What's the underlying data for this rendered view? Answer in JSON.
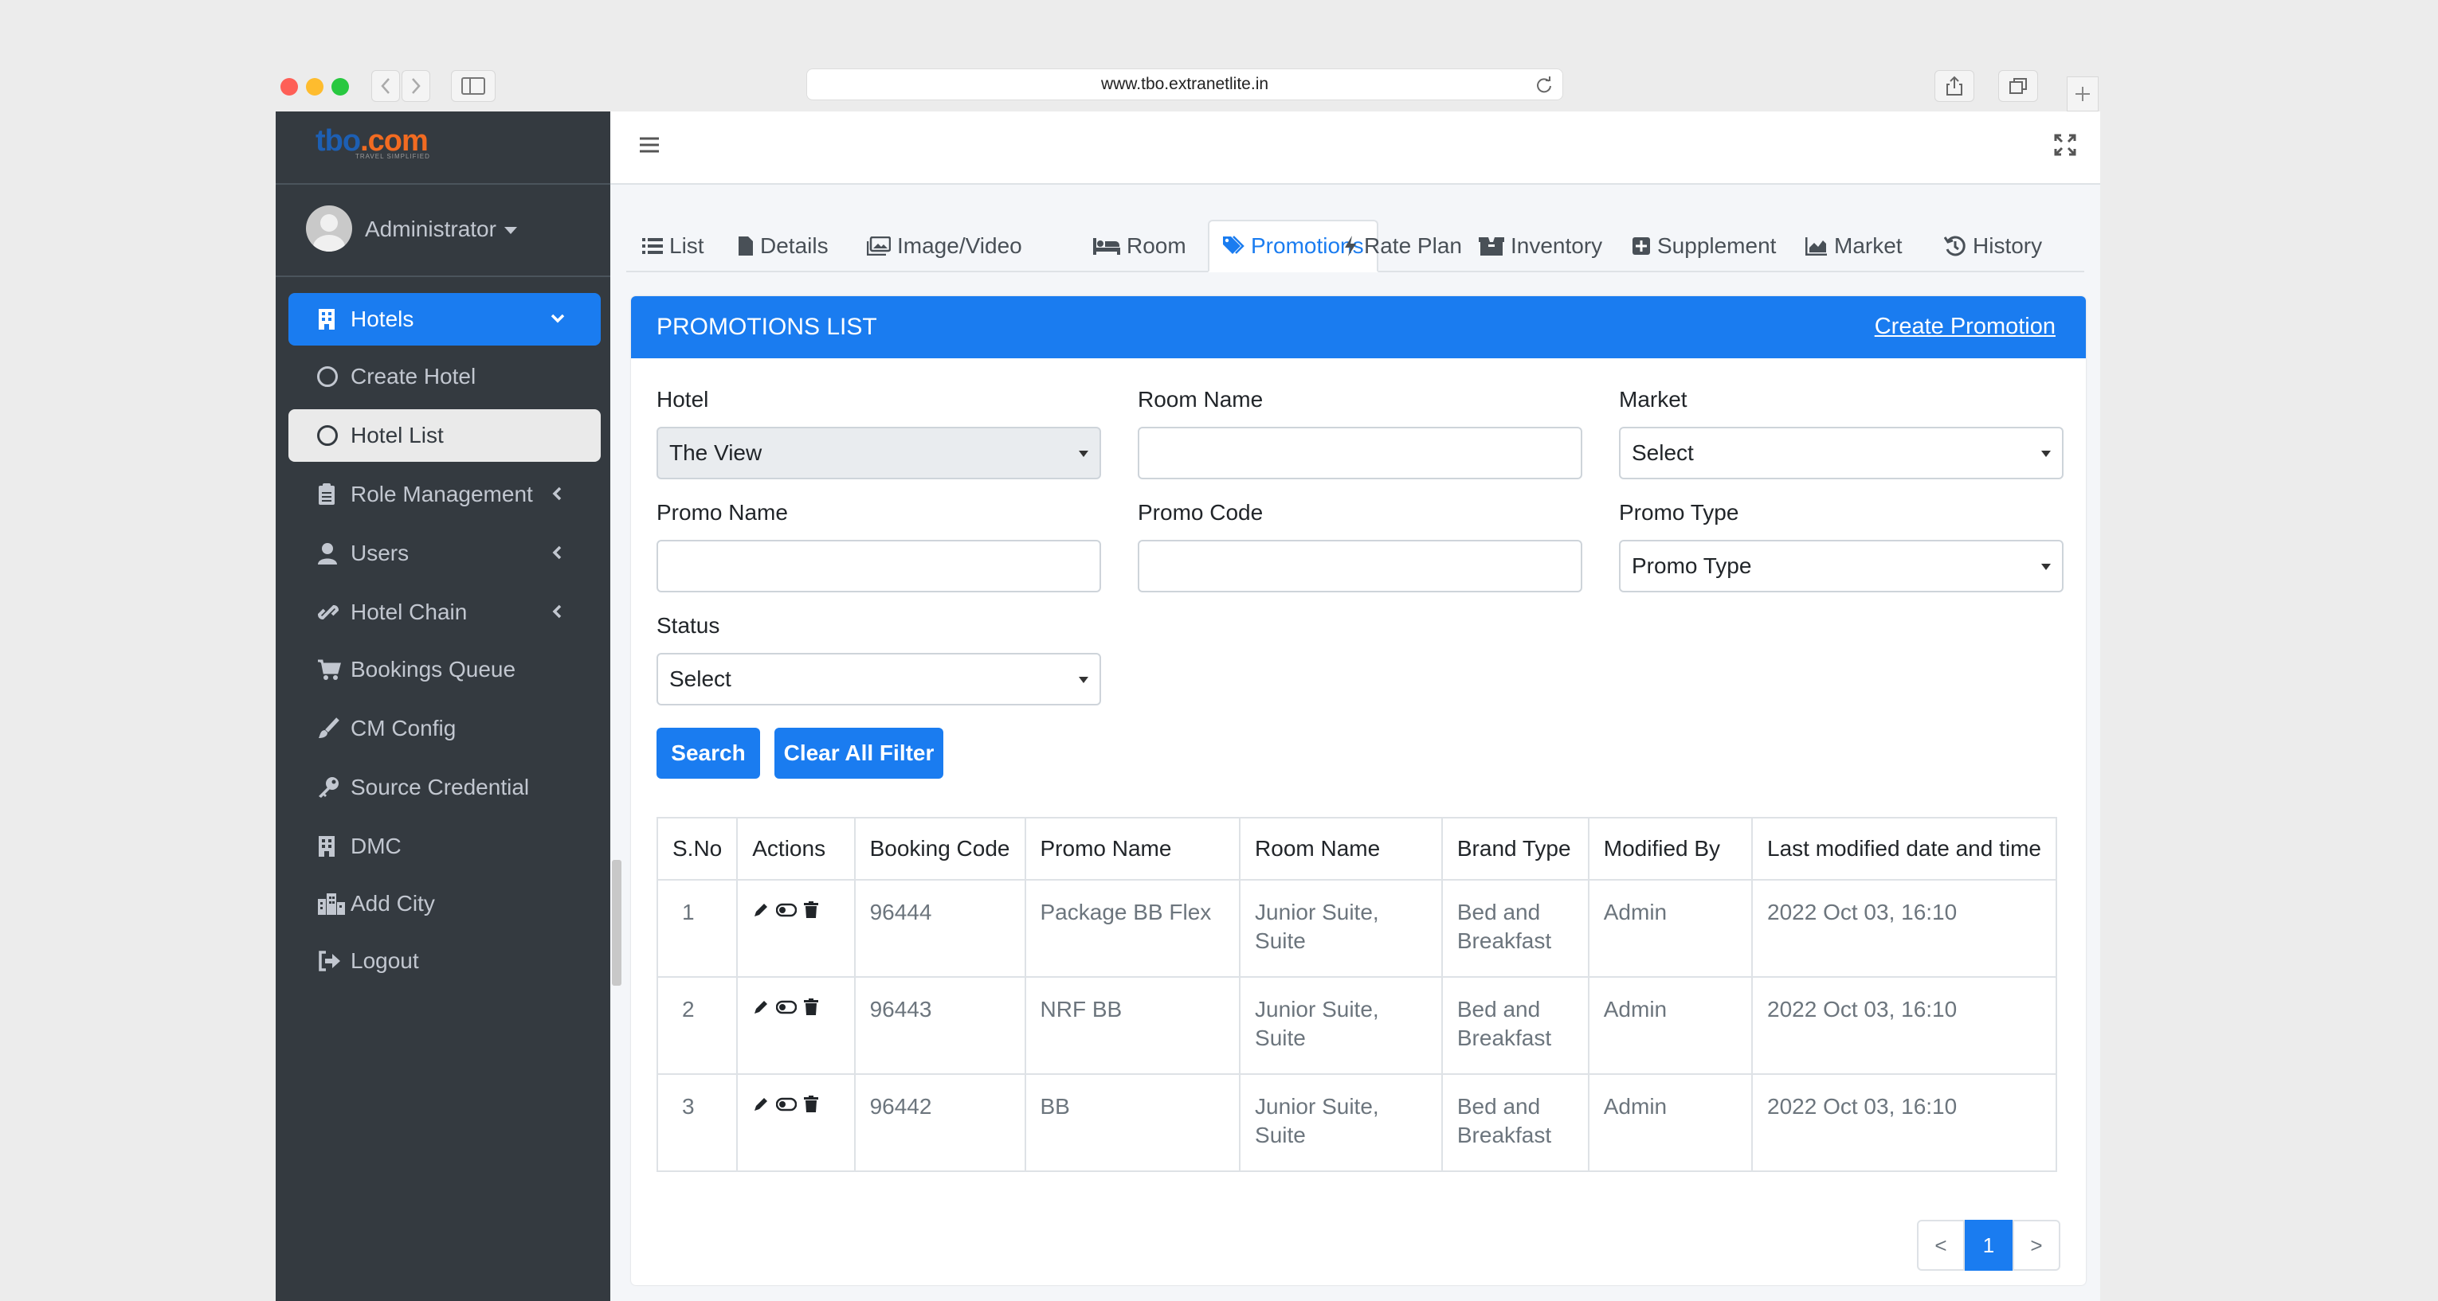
{
  "browser": {
    "url": "www.tbo.extranetlite.in",
    "traffic_colors": [
      "#fe5f57",
      "#febc2e",
      "#28c840"
    ]
  },
  "brand": {
    "logo_part1": "tbo",
    "logo_part2": ".com",
    "tagline": "TRAVEL SIMPLIFIED",
    "primary": "#1d5fb3",
    "accent": "#f26b21"
  },
  "user": {
    "name": "Administrator"
  },
  "sidebar": {
    "items": [
      {
        "label": "Hotels",
        "icon": "building-icon"
      },
      {
        "label": "Create Hotel",
        "icon": "circle-icon"
      },
      {
        "label": "Hotel List",
        "icon": "circle-icon"
      },
      {
        "label": "Role Management",
        "icon": "clipboard-icon"
      },
      {
        "label": "Users",
        "icon": "user-icon"
      },
      {
        "label": "Hotel Chain",
        "icon": "link-icon"
      },
      {
        "label": "Bookings Queue",
        "icon": "cart-icon"
      },
      {
        "label": "CM Config",
        "icon": "brush-icon"
      },
      {
        "label": "Source Credential",
        "icon": "key-icon"
      },
      {
        "label": "DMC",
        "icon": "building-icon"
      },
      {
        "label": "Add City",
        "icon": "city-icon"
      },
      {
        "label": "Logout",
        "icon": "logout-icon"
      }
    ]
  },
  "tabs": [
    {
      "label": "List",
      "icon": "list-icon"
    },
    {
      "label": "Details",
      "icon": "file-icon"
    },
    {
      "label": "Image/Video",
      "icon": "images-icon"
    },
    {
      "label": "Room",
      "icon": "bed-icon"
    },
    {
      "label": "Promotions",
      "icon": "tags-icon"
    },
    {
      "label": "Rate Plan",
      "icon": "bolt-icon"
    },
    {
      "label": "Inventory",
      "icon": "boxes-icon"
    },
    {
      "label": "Supplement",
      "icon": "plus-square-icon"
    },
    {
      "label": "Market",
      "icon": "chart-area-icon"
    },
    {
      "label": "History",
      "icon": "history-icon"
    }
  ],
  "card": {
    "title": "PROMOTIONS LIST",
    "create_link": "Create Promotion"
  },
  "filters": {
    "hotel": {
      "label": "Hotel",
      "value": "The View"
    },
    "room_name": {
      "label": "Room Name",
      "value": ""
    },
    "market": {
      "label": "Market",
      "value": "Select"
    },
    "promo_name": {
      "label": "Promo Name",
      "value": ""
    },
    "promo_code": {
      "label": "Promo Code",
      "value": ""
    },
    "promo_type": {
      "label": "Promo Type",
      "value": "Promo Type"
    },
    "status": {
      "label": "Status",
      "value": "Select"
    }
  },
  "buttons": {
    "search": "Search",
    "clear": "Clear All Filter"
  },
  "table": {
    "headers": [
      "S.No",
      "Actions",
      "Booking Code",
      "Promo Name",
      "Room Name",
      "Brand Type",
      "Modified By",
      "Last modified date and time"
    ],
    "rows": [
      {
        "sno": "1",
        "booking_code": "96444",
        "promo_name": "Package BB Flex",
        "room_name": "Junior Suite, Suite",
        "brand_type": "Bed and Breakfast",
        "modified_by": "Admin",
        "modified_at": "2022 Oct 03, 16:10"
      },
      {
        "sno": "2",
        "booking_code": "96443",
        "promo_name": "NRF BB",
        "room_name": "Junior Suite, Suite",
        "brand_type": "Bed and Breakfast",
        "modified_by": "Admin",
        "modified_at": "2022 Oct 03, 16:10"
      },
      {
        "sno": "3",
        "booking_code": "96442",
        "promo_name": "BB",
        "room_name": "Junior Suite, Suite",
        "brand_type": "Bed and Breakfast",
        "modified_by": "Admin",
        "modified_at": "2022 Oct 03, 16:10"
      }
    ]
  },
  "pagination": {
    "prev": "<",
    "current": "1",
    "next": ">"
  },
  "colors": {
    "primary": "#1a7cf0",
    "sidebar": "#343a40"
  }
}
